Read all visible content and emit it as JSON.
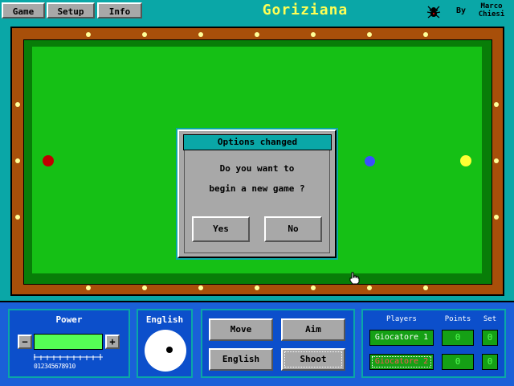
{
  "menu": {
    "game": "Game",
    "setup": "Setup",
    "info": "Info"
  },
  "app_title": "Goriziana",
  "credit": {
    "by": "By",
    "author_first": "Marco",
    "author_last": "Chiesi"
  },
  "dialog": {
    "title": "Options changed",
    "line1": "Do you want to",
    "line2": "begin a new game ?",
    "yes": "Yes",
    "no": "No"
  },
  "balls": {
    "red": "#c00000",
    "blue": "#3a4fff",
    "yellow": "#ffff33"
  },
  "power": {
    "label": "Power",
    "minus": "−",
    "plus": "+",
    "scale": "012345678910",
    "level_fraction": 1.0
  },
  "english": {
    "label": "English"
  },
  "actions": {
    "move": "Move",
    "aim": "Aim",
    "english": "English",
    "shoot": "Shoot"
  },
  "scoreboard": {
    "players_header": "Players",
    "points_header": "Points",
    "set_header": "Set",
    "players": [
      {
        "name": "Giocatore 1",
        "points": "0",
        "set": "0",
        "color": "#ffffff"
      },
      {
        "name": "Giocatore 2",
        "points": "0",
        "set": "0",
        "color": "#ff5555"
      }
    ]
  }
}
